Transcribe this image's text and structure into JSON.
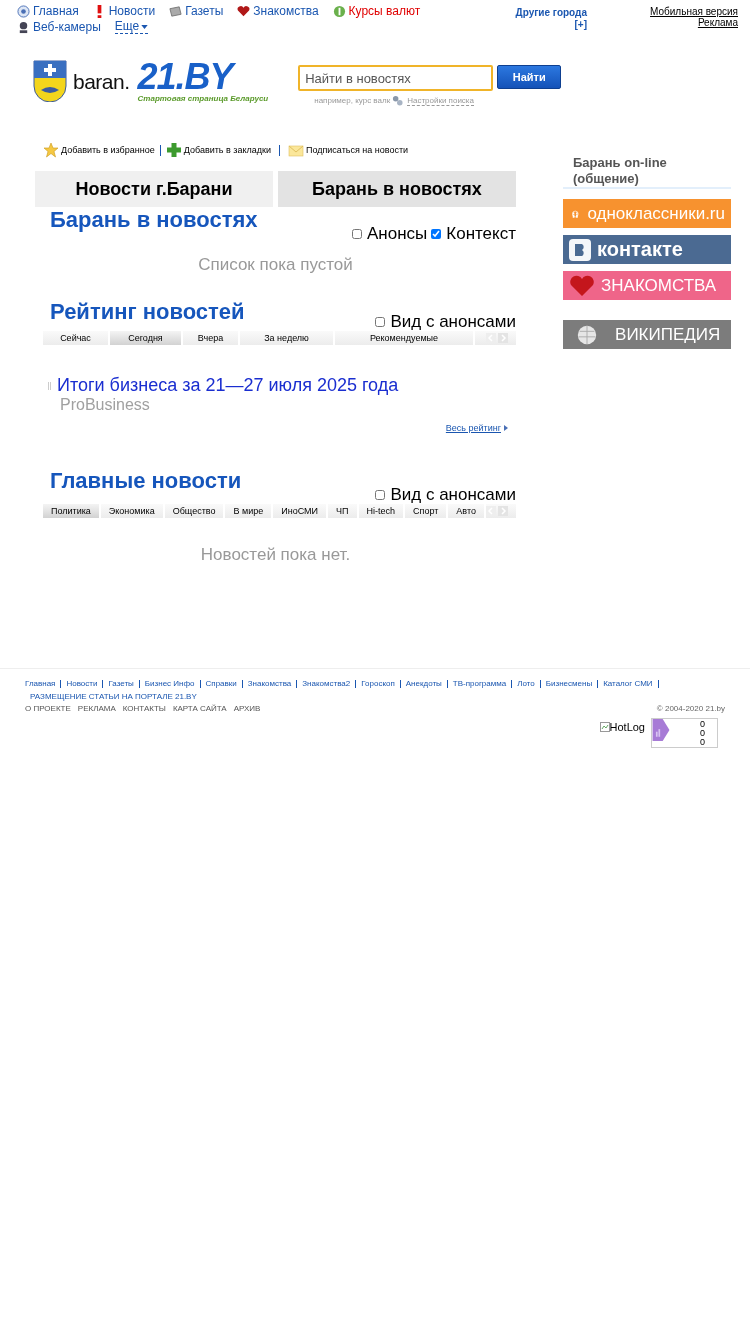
{
  "top_nav": {
    "items": [
      {
        "label": "Главная",
        "kind": "home",
        "color": "#1a56b0"
      },
      {
        "label": "Новости",
        "kind": "alert",
        "color": "#1a56b0"
      },
      {
        "label": "Газеты",
        "kind": "paper",
        "color": "#1a56b0"
      },
      {
        "label": "Знакомства",
        "kind": "heart",
        "color": "#1a56b0"
      },
      {
        "label": "Курсы валют",
        "kind": "dollar",
        "color": "#e00000"
      },
      {
        "label": "Веб-камеры",
        "kind": "webcam",
        "color": "#1a56b0"
      }
    ],
    "more": "Еще",
    "other_cities": "Другие города",
    "other_cities_toggle": "[+]",
    "mobile_link": "Мобильная версия",
    "ads_link": "Реклама"
  },
  "logo": {
    "city": "baran.",
    "brand": "21.BY",
    "slogan": "Стартовая страница Беларуси"
  },
  "search": {
    "placeholder": "Найти в новостях",
    "button": "Найти",
    "hint": "например, курс валк",
    "settings": "Настройки поиска"
  },
  "actions": [
    {
      "label": "Добавить в избранное",
      "kind": "star"
    },
    {
      "label": "Добавить в закладки",
      "kind": "plus"
    },
    {
      "label": "Подписаться на новости",
      "kind": "mail"
    }
  ],
  "tabs": [
    {
      "label": "Новости г.Барани",
      "selected": false
    },
    {
      "label": "Барань в новостях",
      "selected": true
    }
  ],
  "city_news": {
    "title": "Барань в новостях",
    "options": [
      {
        "label": "Анонсы",
        "checked": false
      },
      {
        "label": "Контекст",
        "checked": true
      }
    ],
    "empty": "Список пока пустой"
  },
  "rating": {
    "title": "Рейтинг новостей",
    "option": {
      "label": "Вид с анонсами",
      "checked": false
    },
    "tabs": [
      {
        "label": "Сейчас",
        "selected": false
      },
      {
        "label": "Сегодня",
        "selected": true
      },
      {
        "label": "Вчера",
        "selected": false
      },
      {
        "label": "За неделю",
        "selected": false
      },
      {
        "label": "Рекомендуемые",
        "selected": false
      }
    ],
    "items": [
      {
        "title": "Итоги бизнеса за 21—27 июля 2025 года",
        "source": "ProBusiness"
      }
    ],
    "all_link": "Весь рейтинг"
  },
  "main_news": {
    "title": "Главные новости",
    "option": {
      "label": "Вид с анонсами",
      "checked": false
    },
    "tabs": [
      {
        "label": "Политика",
        "selected": true
      },
      {
        "label": "Экономика",
        "selected": false
      },
      {
        "label": "Общество",
        "selected": false
      },
      {
        "label": "В мире",
        "selected": false
      },
      {
        "label": "ИноСМИ",
        "selected": false
      },
      {
        "label": "ЧП",
        "selected": false
      },
      {
        "label": "Hi-tech",
        "selected": false
      },
      {
        "label": "Спорт",
        "selected": false
      },
      {
        "label": "Авто",
        "selected": false
      }
    ],
    "empty": "Новостей пока нет."
  },
  "sidebar": {
    "title": "Барань on-line (общение)",
    "banners": [
      {
        "label": "одноклассники.ru",
        "kind": "ok"
      },
      {
        "label": "контакте",
        "kind": "vk"
      },
      {
        "label": "ЗНАКОМСТВА",
        "kind": "dating"
      },
      {
        "label": "ВИКИПЕДИЯ",
        "kind": "wiki"
      }
    ]
  },
  "footer": {
    "links": [
      "Главная",
      "Новости",
      "Газеты",
      "Бизнес Инфо",
      "Справки",
      "Знакомства",
      "Знакомства2",
      "Гороскоп",
      "Анекдоты",
      "ТВ-программа",
      "Лото",
      "Бизнесмены",
      "Каталог СМИ"
    ],
    "placement": "РАЗМЕЩЕНИЕ СТАТЬИ НА ПОРТАЛЕ 21.BY",
    "bottom_links": [
      "О ПРОЕКТЕ",
      "РЕКЛАМА",
      "КОНТАКТЫ",
      "КАРТА САЙТА",
      "АРХИВ"
    ],
    "copyright": "© 2004-2020 21.by",
    "hotlog": "HotLog",
    "counter": [
      "0",
      "0",
      "0"
    ]
  }
}
